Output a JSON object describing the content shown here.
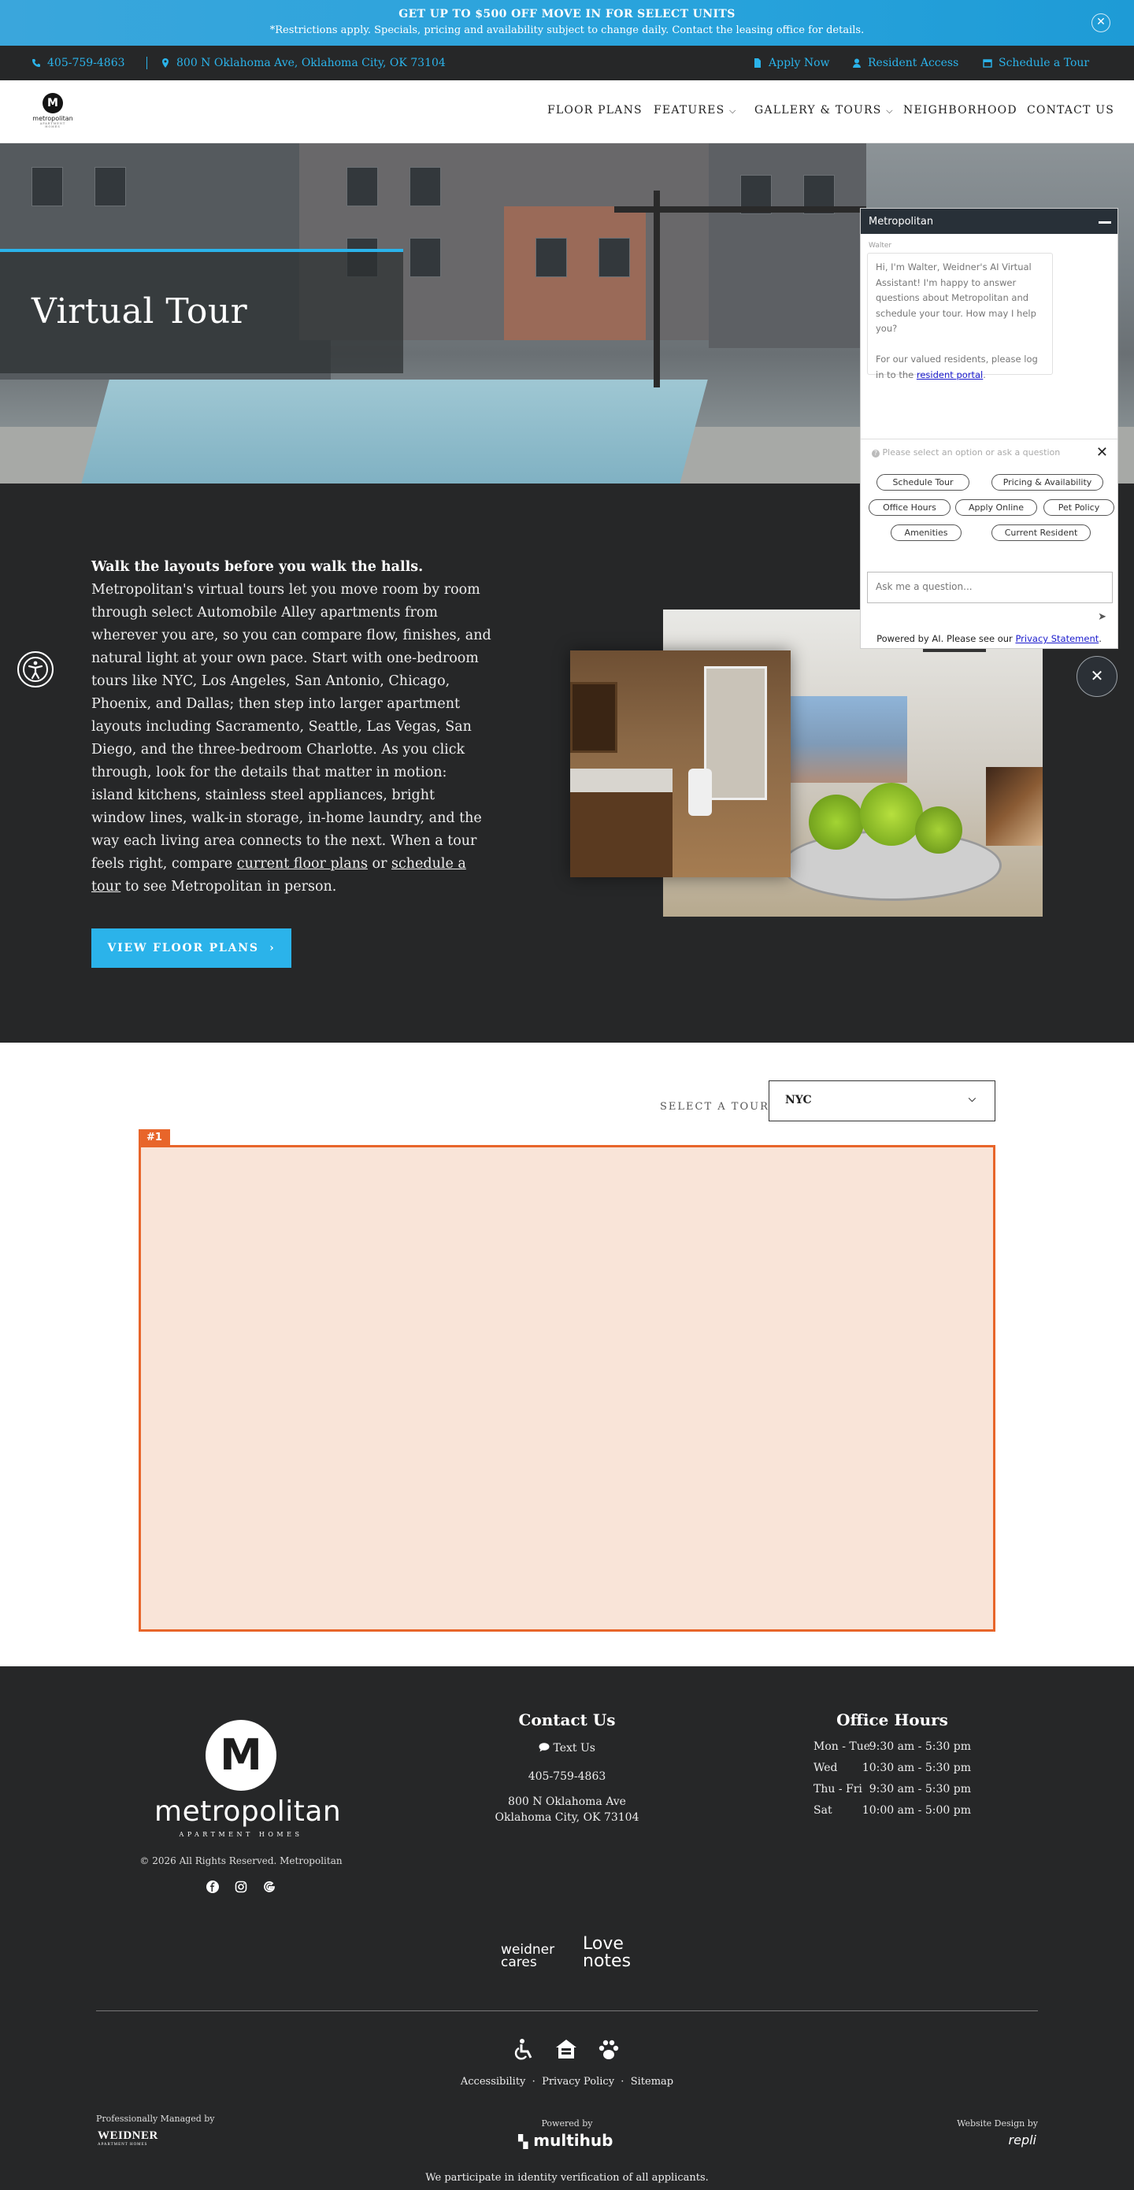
{
  "promo": {
    "headline": "GET UP TO $500 OFF MOVE IN FOR SELECT UNITS",
    "subtext": "*Restrictions apply. Specials, pricing and availability subject to change daily. Contact the leasing office for details.",
    "close_glyph": "✕"
  },
  "utility_bar": {
    "phone": "405-759-4863",
    "address": "800 N Oklahoma Ave, Oklahoma City, OK 73104",
    "apply": "Apply Now",
    "resident": "Resident Access",
    "tour": "Schedule a Tour",
    "accent": "#2bb3ea"
  },
  "nav": {
    "logo_letter": "M",
    "logo_word": "metropolitan",
    "logo_sub": "APARTMENT HOMES",
    "links": [
      "FLOOR PLANS",
      "FEATURES",
      "GALLERY & TOURS",
      "NEIGHBORHOOD",
      "CONTACT US"
    ],
    "chevron": "⌵"
  },
  "hero": {
    "title": "Virtual Tour"
  },
  "intro": {
    "lead": "Walk the layouts before you walk the halls.",
    "body_1": "Metropolitan's virtual tours let you move room by room through select Automobile Alley apartments from wherever you are, so you can compare flow, finishes, and natural light at your own pace. Start with one-bedroom tours like NYC, Los Angeles, San Antonio, Chicago, Phoenix, and Dallas; then step into larger apartment layouts including Sacramento, Seattle, Las Vegas, San Diego, and the three-bedroom Charlotte. As you click through, look for the details that matter in motion: island kitchens, stainless steel appliances, bright window lines, walk-in storage, in-home laundry, and the way each living area connects to the next. When a tour feels right, compare ",
    "link_1": "current floor plans",
    "or": " or ",
    "link_2": "schedule a tour",
    "body_2": " to see Metropolitan in person.",
    "button": "VIEW FLOOR PLANS",
    "button_arrow": "›"
  },
  "tour": {
    "select_label": "SELECT A TOUR",
    "selected": "NYC",
    "tag": "#1"
  },
  "chat": {
    "title": "Metropolitan",
    "bot_name": "Walter",
    "greeting": "Hi, I'm Walter, Weidner's AI Virtual Assistant! I'm happy to answer questions about Metropolitan and schedule your tour. How may I help you?",
    "resident_note": "For our valued residents, please log in to the ",
    "resident_link": "resident portal",
    "hint": "Please select an option or ask a question",
    "options": [
      "Schedule Tour",
      "Pricing & Availability",
      "Office Hours",
      "Apply Online",
      "Pet Policy",
      "Amenities",
      "Current Resident"
    ],
    "input_placeholder": "Ask me a question...",
    "powered_text": "Powered by AI. Please see our ",
    "privacy_link": "Privacy Statement",
    "close_glyph": "✕"
  },
  "footer": {
    "copyright": "© 2026 All Rights Reserved. Metropolitan",
    "contact_title": "Contact Us",
    "text_us": "Text Us",
    "phone": "405-759-4863",
    "addr_1": "800 N Oklahoma Ave",
    "addr_2": "Oklahoma City, OK 73104",
    "hours_title": "Office Hours",
    "hours": [
      {
        "day": "Mon - Tue",
        "time": "9:30 am - 5:30 pm"
      },
      {
        "day": "Wed",
        "time": "10:30 am - 5:30 pm"
      },
      {
        "day": "Thu - Fri",
        "time": "9:30 am - 5:30 pm"
      },
      {
        "day": "Sat",
        "time": "10:00 am - 5:00 pm"
      }
    ],
    "weidner_cares": "weidner cares",
    "love_notes_1": "Love",
    "love_notes_2": "notes",
    "link_access": "Accessibility",
    "link_privacy": "Privacy Policy",
    "link_sitemap": "Sitemap",
    "managed_by": "Professionally Managed by",
    "weidner": "WEIDNER",
    "weidner_sub": "APARTMENT HOMES",
    "powered_by": "Powered by",
    "multihub": "multihub",
    "design_by": "Website Design by",
    "repli": "repli",
    "verify": "We participate in identity verification of all applicants."
  }
}
